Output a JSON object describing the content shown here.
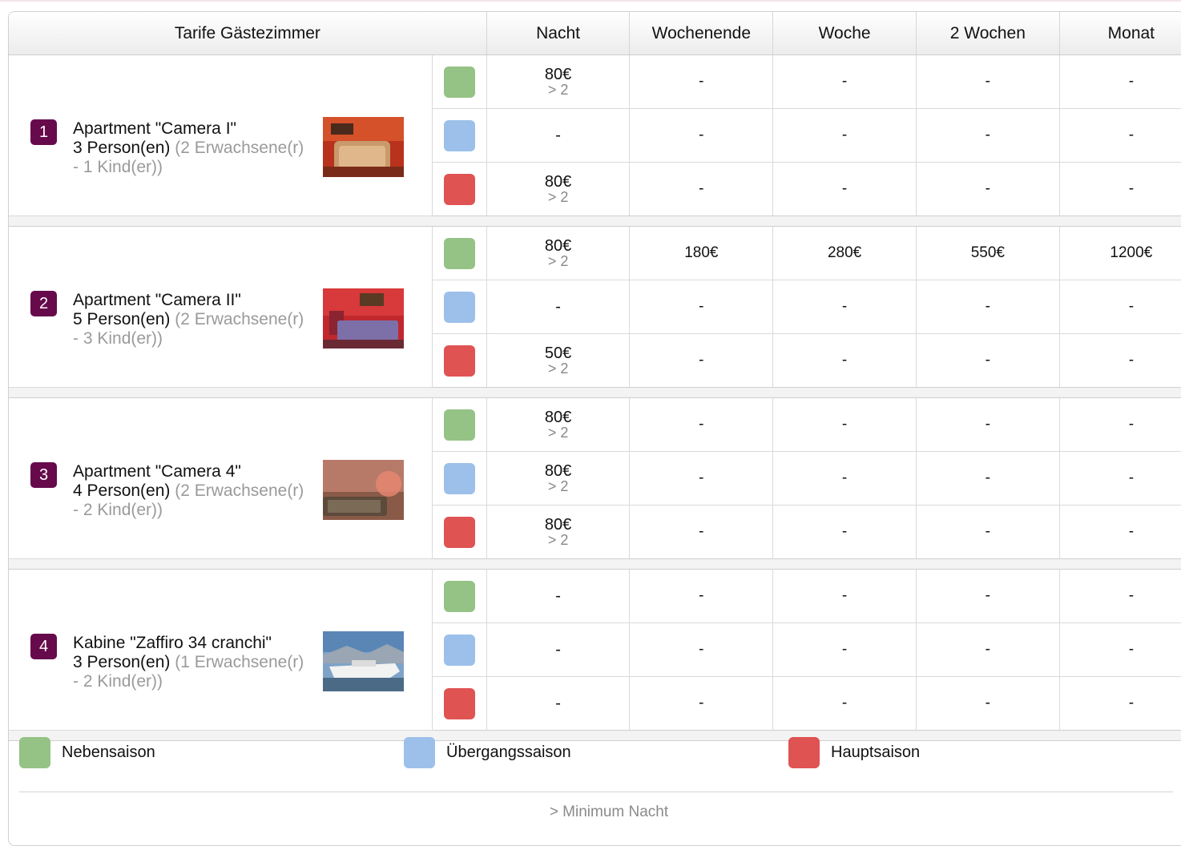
{
  "table": {
    "headers": {
      "room": "Tarife Gästezimmer",
      "night": "Nacht",
      "weekend": "Wochenende",
      "week": "Woche",
      "two_weeks": "2 Wochen",
      "month": "Monat"
    }
  },
  "season_colors": {
    "low": "#95c285",
    "mid": "#9cc0ea",
    "high": "#e05353"
  },
  "rooms": [
    {
      "number": "1",
      "name": "Apartment \"Camera I\"",
      "persons": "3 Person(en)",
      "breakdown": "(2 Erwachsene(r) - 1 Kind(er))",
      "rows": [
        {
          "night": "80€",
          "min": "> 2",
          "weekend": "-",
          "week": "-",
          "two_weeks": "-",
          "month": "-"
        },
        {
          "night": "-",
          "min": "",
          "weekend": "-",
          "week": "-",
          "two_weeks": "-",
          "month": "-"
        },
        {
          "night": "80€",
          "min": "> 2",
          "weekend": "-",
          "week": "-",
          "two_weeks": "-",
          "month": "-"
        }
      ]
    },
    {
      "number": "2",
      "name": "Apartment \"Camera II\"",
      "persons": "5 Person(en)",
      "breakdown": "(2 Erwachsene(r) - 3 Kind(er))",
      "rows": [
        {
          "night": "80€",
          "min": "> 2",
          "weekend": "180€",
          "week": "280€",
          "two_weeks": "550€",
          "month": "1200€"
        },
        {
          "night": "-",
          "min": "",
          "weekend": "-",
          "week": "-",
          "two_weeks": "-",
          "month": "-"
        },
        {
          "night": "50€",
          "min": "> 2",
          "weekend": "-",
          "week": "-",
          "two_weeks": "-",
          "month": "-"
        }
      ]
    },
    {
      "number": "3",
      "name": "Apartment \"Camera 4\"",
      "persons": "4 Person(en)",
      "breakdown": "(2 Erwachsene(r) - 2 Kind(er))",
      "rows": [
        {
          "night": "80€",
          "min": "> 2",
          "weekend": "-",
          "week": "-",
          "two_weeks": "-",
          "month": "-"
        },
        {
          "night": "80€",
          "min": "> 2",
          "weekend": "-",
          "week": "-",
          "two_weeks": "-",
          "month": "-"
        },
        {
          "night": "80€",
          "min": "> 2",
          "weekend": "-",
          "week": "-",
          "two_weeks": "-",
          "month": "-"
        }
      ]
    },
    {
      "number": "4",
      "name": "Kabine \"Zaffiro 34 cranchi\"",
      "persons": "3 Person(en)",
      "breakdown": "(1 Erwachsene(r) - 2 Kind(er))",
      "rows": [
        {
          "night": "-",
          "min": "",
          "weekend": "-",
          "week": "-",
          "two_weeks": "-",
          "month": "-"
        },
        {
          "night": "-",
          "min": "",
          "weekend": "-",
          "week": "-",
          "two_weeks": "-",
          "month": "-"
        },
        {
          "night": "-",
          "min": "",
          "weekend": "-",
          "week": "-",
          "two_weeks": "-",
          "month": "-"
        }
      ]
    }
  ],
  "legend": {
    "low": "Nebensaison",
    "mid": "Übergangssaison",
    "high": "Hauptsaison"
  },
  "footnote": "> Minimum Nacht"
}
